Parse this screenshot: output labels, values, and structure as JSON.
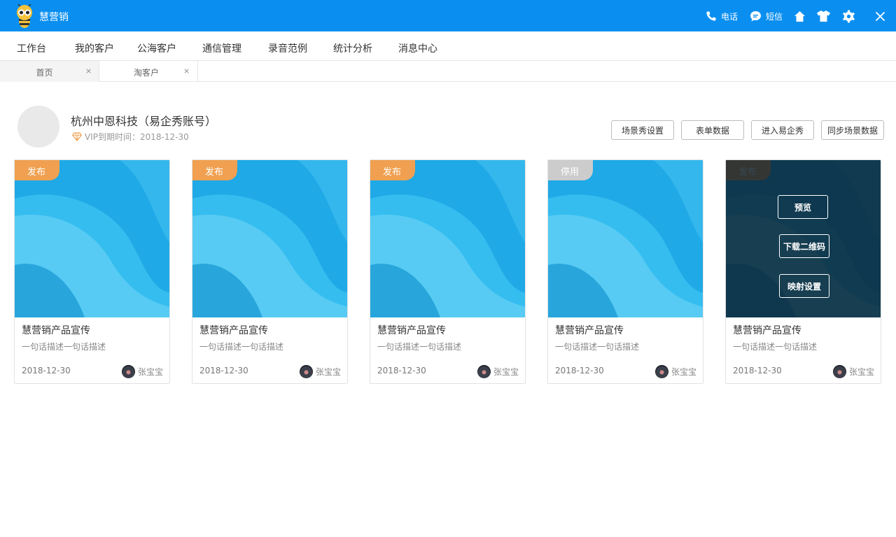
{
  "app": {
    "title": "慧营销"
  },
  "toolbar": {
    "phone_label": "电话",
    "sms_label": "短信"
  },
  "menu": {
    "items": [
      "工作台",
      "我的客户",
      "公海客户",
      "通信管理",
      "录音范例",
      "统计分析",
      "消息中心"
    ]
  },
  "tabs": [
    {
      "label": "首页",
      "close": "×"
    },
    {
      "label": "淘客户",
      "close": "×"
    }
  ],
  "account": {
    "name": "杭州中恩科技（易企秀账号）",
    "vip_prefix": "VIP到期时间：",
    "vip_date": "2018-12-30"
  },
  "actions": {
    "scene_settings": "场景秀设置",
    "form_data": "表单数据",
    "enter_eqxiu": "进入易企秀",
    "sync_scene": "同步场景数据"
  },
  "cards": [
    {
      "badge": "发布",
      "title": "慧营销产品宣传",
      "desc": "一句话描述一句话描述",
      "date": "2018-12-30",
      "author": "张宝宝"
    },
    {
      "badge": "发布",
      "title": "慧营销产品宣传",
      "desc": "一句话描述一句话描述",
      "date": "2018-12-30",
      "author": "张宝宝"
    },
    {
      "badge": "发布",
      "title": "慧营销产品宣传",
      "desc": "一句话描述一句话描述",
      "date": "2018-12-30",
      "author": "张宝宝"
    },
    {
      "badge": "停用",
      "title": "慧营销产品宣传",
      "desc": "一句话描述一句话描述",
      "date": "2018-12-30",
      "author": "张宝宝"
    },
    {
      "badge": "发布",
      "title": "慧营销产品宣传",
      "desc": "一句话描述一句话描述",
      "date": "2018-12-30",
      "author": "张宝宝"
    }
  ],
  "hover_actions": {
    "preview": "预览",
    "download_qr": "下载二维码",
    "mapping": "映射设置"
  },
  "colors": {
    "titlebar": "#0a8ff0",
    "badge_published": "#f0a050",
    "badge_disabled": "#cccccc"
  },
  "icons": [
    "bee-logo-icon",
    "phone-icon",
    "message-icon",
    "home-icon",
    "shirt-icon",
    "gear-icon",
    "close-icon",
    "diamond-icon"
  ]
}
